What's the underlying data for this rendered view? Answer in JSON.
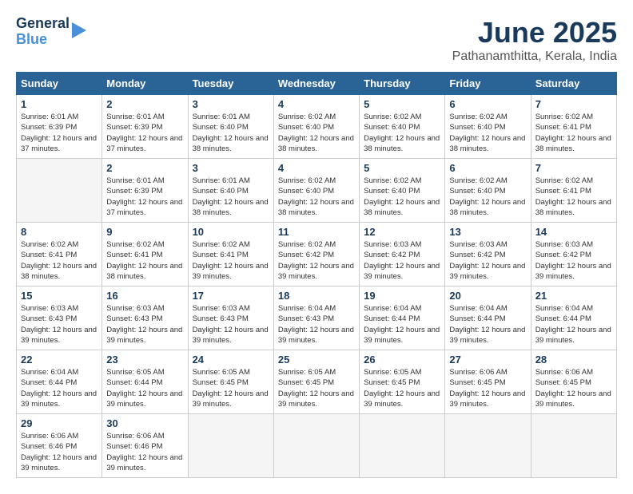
{
  "header": {
    "logo_general": "General",
    "logo_blue": "Blue",
    "month_title": "June 2025",
    "location": "Pathanamthitta, Kerala, India"
  },
  "calendar": {
    "headers": [
      "Sunday",
      "Monday",
      "Tuesday",
      "Wednesday",
      "Thursday",
      "Friday",
      "Saturday"
    ],
    "weeks": [
      [
        {
          "day": "",
          "empty": true
        },
        {
          "day": "2",
          "sunrise": "Sunrise: 6:01 AM",
          "sunset": "Sunset: 6:39 PM",
          "daylight": "Daylight: 12 hours and 37 minutes."
        },
        {
          "day": "3",
          "sunrise": "Sunrise: 6:01 AM",
          "sunset": "Sunset: 6:40 PM",
          "daylight": "Daylight: 12 hours and 38 minutes."
        },
        {
          "day": "4",
          "sunrise": "Sunrise: 6:02 AM",
          "sunset": "Sunset: 6:40 PM",
          "daylight": "Daylight: 12 hours and 38 minutes."
        },
        {
          "day": "5",
          "sunrise": "Sunrise: 6:02 AM",
          "sunset": "Sunset: 6:40 PM",
          "daylight": "Daylight: 12 hours and 38 minutes."
        },
        {
          "day": "6",
          "sunrise": "Sunrise: 6:02 AM",
          "sunset": "Sunset: 6:40 PM",
          "daylight": "Daylight: 12 hours and 38 minutes."
        },
        {
          "day": "7",
          "sunrise": "Sunrise: 6:02 AM",
          "sunset": "Sunset: 6:41 PM",
          "daylight": "Daylight: 12 hours and 38 minutes."
        }
      ],
      [
        {
          "day": "8",
          "sunrise": "Sunrise: 6:02 AM",
          "sunset": "Sunset: 6:41 PM",
          "daylight": "Daylight: 12 hours and 38 minutes."
        },
        {
          "day": "9",
          "sunrise": "Sunrise: 6:02 AM",
          "sunset": "Sunset: 6:41 PM",
          "daylight": "Daylight: 12 hours and 38 minutes."
        },
        {
          "day": "10",
          "sunrise": "Sunrise: 6:02 AM",
          "sunset": "Sunset: 6:41 PM",
          "daylight": "Daylight: 12 hours and 39 minutes."
        },
        {
          "day": "11",
          "sunrise": "Sunrise: 6:02 AM",
          "sunset": "Sunset: 6:42 PM",
          "daylight": "Daylight: 12 hours and 39 minutes."
        },
        {
          "day": "12",
          "sunrise": "Sunrise: 6:03 AM",
          "sunset": "Sunset: 6:42 PM",
          "daylight": "Daylight: 12 hours and 39 minutes."
        },
        {
          "day": "13",
          "sunrise": "Sunrise: 6:03 AM",
          "sunset": "Sunset: 6:42 PM",
          "daylight": "Daylight: 12 hours and 39 minutes."
        },
        {
          "day": "14",
          "sunrise": "Sunrise: 6:03 AM",
          "sunset": "Sunset: 6:42 PM",
          "daylight": "Daylight: 12 hours and 39 minutes."
        }
      ],
      [
        {
          "day": "15",
          "sunrise": "Sunrise: 6:03 AM",
          "sunset": "Sunset: 6:43 PM",
          "daylight": "Daylight: 12 hours and 39 minutes."
        },
        {
          "day": "16",
          "sunrise": "Sunrise: 6:03 AM",
          "sunset": "Sunset: 6:43 PM",
          "daylight": "Daylight: 12 hours and 39 minutes."
        },
        {
          "day": "17",
          "sunrise": "Sunrise: 6:03 AM",
          "sunset": "Sunset: 6:43 PM",
          "daylight": "Daylight: 12 hours and 39 minutes."
        },
        {
          "day": "18",
          "sunrise": "Sunrise: 6:04 AM",
          "sunset": "Sunset: 6:43 PM",
          "daylight": "Daylight: 12 hours and 39 minutes."
        },
        {
          "day": "19",
          "sunrise": "Sunrise: 6:04 AM",
          "sunset": "Sunset: 6:44 PM",
          "daylight": "Daylight: 12 hours and 39 minutes."
        },
        {
          "day": "20",
          "sunrise": "Sunrise: 6:04 AM",
          "sunset": "Sunset: 6:44 PM",
          "daylight": "Daylight: 12 hours and 39 minutes."
        },
        {
          "day": "21",
          "sunrise": "Sunrise: 6:04 AM",
          "sunset": "Sunset: 6:44 PM",
          "daylight": "Daylight: 12 hours and 39 minutes."
        }
      ],
      [
        {
          "day": "22",
          "sunrise": "Sunrise: 6:04 AM",
          "sunset": "Sunset: 6:44 PM",
          "daylight": "Daylight: 12 hours and 39 minutes."
        },
        {
          "day": "23",
          "sunrise": "Sunrise: 6:05 AM",
          "sunset": "Sunset: 6:44 PM",
          "daylight": "Daylight: 12 hours and 39 minutes."
        },
        {
          "day": "24",
          "sunrise": "Sunrise: 6:05 AM",
          "sunset": "Sunset: 6:45 PM",
          "daylight": "Daylight: 12 hours and 39 minutes."
        },
        {
          "day": "25",
          "sunrise": "Sunrise: 6:05 AM",
          "sunset": "Sunset: 6:45 PM",
          "daylight": "Daylight: 12 hours and 39 minutes."
        },
        {
          "day": "26",
          "sunrise": "Sunrise: 6:05 AM",
          "sunset": "Sunset: 6:45 PM",
          "daylight": "Daylight: 12 hours and 39 minutes."
        },
        {
          "day": "27",
          "sunrise": "Sunrise: 6:06 AM",
          "sunset": "Sunset: 6:45 PM",
          "daylight": "Daylight: 12 hours and 39 minutes."
        },
        {
          "day": "28",
          "sunrise": "Sunrise: 6:06 AM",
          "sunset": "Sunset: 6:45 PM",
          "daylight": "Daylight: 12 hours and 39 minutes."
        }
      ],
      [
        {
          "day": "29",
          "sunrise": "Sunrise: 6:06 AM",
          "sunset": "Sunset: 6:46 PM",
          "daylight": "Daylight: 12 hours and 39 minutes."
        },
        {
          "day": "30",
          "sunrise": "Sunrise: 6:06 AM",
          "sunset": "Sunset: 6:46 PM",
          "daylight": "Daylight: 12 hours and 39 minutes."
        },
        {
          "day": "",
          "empty": true
        },
        {
          "day": "",
          "empty": true
        },
        {
          "day": "",
          "empty": true
        },
        {
          "day": "",
          "empty": true
        },
        {
          "day": "",
          "empty": true
        }
      ]
    ],
    "week1_day1": {
      "day": "1",
      "sunrise": "Sunrise: 6:01 AM",
      "sunset": "Sunset: 6:39 PM",
      "daylight": "Daylight: 12 hours and 37 minutes."
    }
  }
}
